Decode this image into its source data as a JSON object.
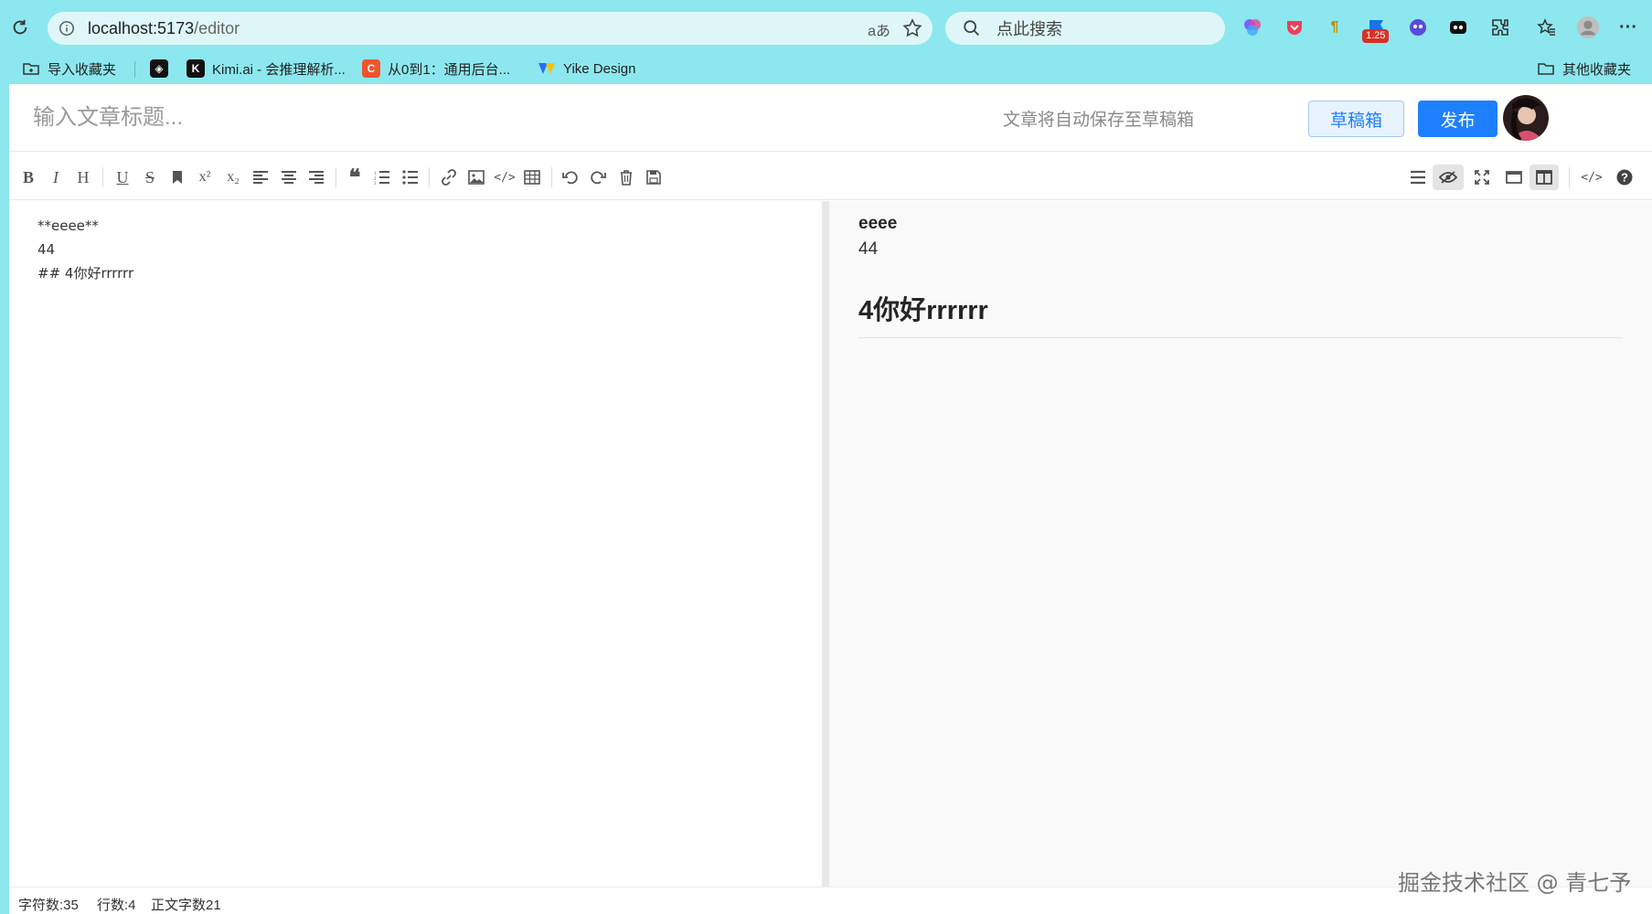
{
  "browser": {
    "url_host": "localhost:5173",
    "url_path": "/editor",
    "readaloud": "aあ",
    "search_placeholder": "点此搜索",
    "ext_badge": "1.25"
  },
  "bookmarks": [
    {
      "label": "导入收藏夹"
    },
    {
      "label": ""
    },
    {
      "label": "Kimi.ai - 会推理解析..."
    },
    {
      "label": "从0到1：通用后台..."
    },
    {
      "label": "Yike Design"
    },
    {
      "label": "其他收藏夹"
    }
  ],
  "header": {
    "title_placeholder": "输入文章标题...",
    "autosave_hint": "文章将自动保存至草稿箱",
    "draft_label": "草稿箱",
    "publish_label": "发布"
  },
  "editor": {
    "content": "**eeee**\n44\n## 4你好rrrrrr"
  },
  "preview": {
    "bold_text": "eeee",
    "line_text": "44",
    "heading_text": "4你好rrrrrr"
  },
  "status": {
    "chars": "字符数:35",
    "lines": "行数:4",
    "body_chars": "正文字数21"
  },
  "watermark": "掘金技术社区 @ 青七予",
  "colors": {
    "browser_bg": "#8ce8ee",
    "accent": "#1e80ff",
    "draft_bg": "#e8f3ff"
  }
}
